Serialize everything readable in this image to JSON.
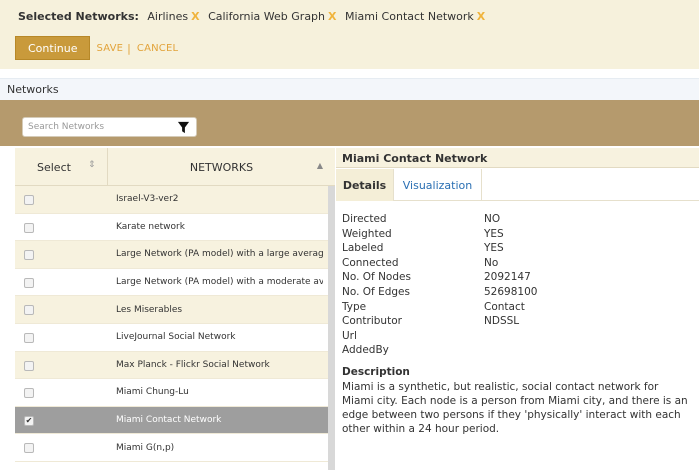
{
  "selected": {
    "title": "Selected Networks:",
    "items": [
      "Airlines",
      "California Web Graph",
      "Miami Contact Network"
    ],
    "remove_glyph": "X"
  },
  "actions": {
    "continue": "Continue",
    "save": "SAVE",
    "separator": "|",
    "cancel": "CANCEL"
  },
  "section_title": "Networks",
  "search": {
    "placeholder": "Search Networks",
    "icon": "filter-icon"
  },
  "table": {
    "col_select": "Select",
    "col_networks": "NETWORKS",
    "rows": [
      {
        "name": "Israel-V3-ver2",
        "checked": false
      },
      {
        "name": "Karate network",
        "checked": false
      },
      {
        "name": "Large Network (PA model) with a large averag...",
        "checked": false
      },
      {
        "name": "Large Network (PA model) with a moderate av...",
        "checked": false
      },
      {
        "name": "Les Miserables",
        "checked": false
      },
      {
        "name": "LiveJournal Social Network",
        "checked": false
      },
      {
        "name": "Max Planck - Flickr Social Network",
        "checked": false
      },
      {
        "name": "Miami Chung-Lu",
        "checked": false
      },
      {
        "name": "Miami Contact Network",
        "checked": true
      },
      {
        "name": "Miami G(n,p)",
        "checked": false
      }
    ]
  },
  "detail": {
    "title": "Miami Contact Network",
    "tabs": [
      "Details",
      "Visualization"
    ],
    "properties": [
      {
        "key": "Directed",
        "value": "NO"
      },
      {
        "key": "Weighted",
        "value": "YES"
      },
      {
        "key": "Labeled",
        "value": "YES"
      },
      {
        "key": "Connected",
        "value": "No"
      },
      {
        "key": "No. Of Nodes",
        "value": "2092147"
      },
      {
        "key": "No. Of Edges",
        "value": "52698100"
      },
      {
        "key": "Type",
        "value": "Contact"
      },
      {
        "key": "Contributor",
        "value": "NDSSL"
      },
      {
        "key": "Url",
        "value": ""
      },
      {
        "key": "AddedBy",
        "value": ""
      }
    ],
    "description_label": "Description",
    "description": "Miami is a synthetic, but realistic, social contact network for Miami city. Each node is a person from Miami city, and there is an edge between two persons if they 'physically' interact with each other within a 24 hour period."
  },
  "colors": {
    "accent": "#c99a3b",
    "band": "#b59a6d",
    "remove_x": "#f0b43c",
    "link": "#2a6fb3",
    "selected_row": "#9e9e9e"
  }
}
